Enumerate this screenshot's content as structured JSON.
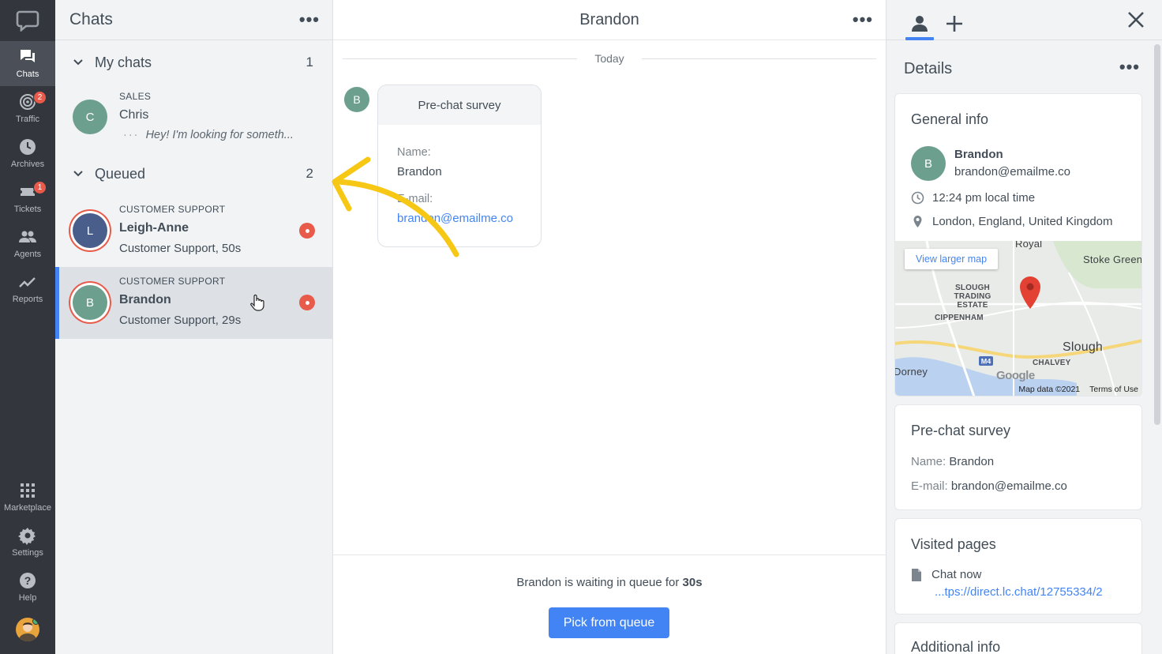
{
  "nav": {
    "items": [
      {
        "label": "Chats",
        "icon": "chats-icon",
        "active": true
      },
      {
        "label": "Traffic",
        "icon": "traffic-icon",
        "badge": "2"
      },
      {
        "label": "Archives",
        "icon": "clock-icon"
      },
      {
        "label": "Tickets",
        "icon": "ticket-icon",
        "badge": "1"
      },
      {
        "label": "Agents",
        "icon": "agents-icon"
      },
      {
        "label": "Reports",
        "icon": "reports-icon"
      }
    ],
    "bottom": [
      {
        "label": "Marketplace",
        "icon": "grid-icon"
      },
      {
        "label": "Settings",
        "icon": "gear-icon"
      },
      {
        "label": "Help",
        "icon": "help-icon"
      }
    ]
  },
  "chatlist": {
    "title": "Chats",
    "my_chats": {
      "label": "My chats",
      "count": "1",
      "items": [
        {
          "category": "SALES",
          "name": "Chris",
          "initial": "C",
          "preview": "Hey! I'm looking for someth...",
          "color": "#6d9f8e"
        }
      ]
    },
    "queued": {
      "label": "Queued",
      "count": "2",
      "items": [
        {
          "category": "CUSTOMER SUPPORT",
          "name": "Leigh-Anne",
          "initial": "L",
          "sub": "Customer Support, 50s",
          "color": "#4a5e8c"
        },
        {
          "category": "CUSTOMER SUPPORT",
          "name": "Brandon",
          "initial": "B",
          "sub": "Customer Support, 29s",
          "color": "#6d9f8e"
        }
      ]
    }
  },
  "main": {
    "title": "Brandon",
    "date_divider": "Today",
    "avatar_initial": "B",
    "survey": {
      "title": "Pre-chat survey",
      "name_label": "Name:",
      "name_value": "Brandon",
      "email_label": "E-mail:",
      "email_value": "brandon@emailme.co"
    },
    "queue": {
      "text_prefix": "Brandon is waiting in queue for ",
      "time": "30s",
      "button": "Pick from queue"
    }
  },
  "details": {
    "title": "Details",
    "general": {
      "title": "General info",
      "initial": "B",
      "name": "Brandon",
      "email": "brandon@emailme.co",
      "local_time": "12:24 pm local time",
      "location": "London, England, United Kingdom",
      "map": {
        "button": "View larger map",
        "labels": [
          "Royal",
          "Stoke Green",
          "Slough Trading Estate",
          "Cippenham",
          "Slough",
          "Chalvey",
          "Dorney",
          "M4"
        ],
        "google": "Google",
        "map_data": "Map data ©2021",
        "terms": "Terms of Use"
      }
    },
    "survey": {
      "title": "Pre-chat survey",
      "name_label": "Name:",
      "name_value": "Brandon",
      "email_label": "E-mail:",
      "email_value": "brandon@emailme.co"
    },
    "visited": {
      "title": "Visited pages",
      "page_title": "Chat now",
      "page_url": "...tps://direct.lc.chat/12755334/2"
    },
    "additional": {
      "title": "Additional info"
    }
  },
  "colors": {
    "accent": "#4384f5",
    "alert": "#e85b4b",
    "annotation_arrow": "#f7c715"
  }
}
